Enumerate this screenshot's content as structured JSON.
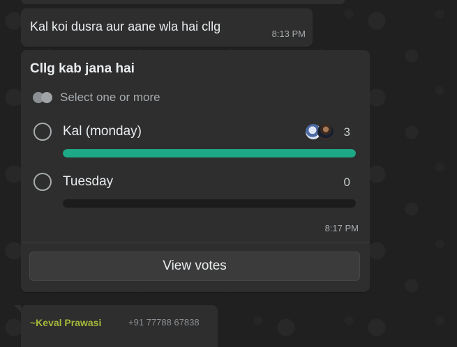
{
  "messages": [
    {
      "text": "Kal koi dusra aur aane wla hai cllg",
      "time": "8:13 PM"
    }
  ],
  "poll": {
    "question": "Cllg kab jana hai",
    "select_hint": "Select one or more",
    "options": [
      {
        "label": "Kal (monday)",
        "votes": "3",
        "fill_fraction": 1.0,
        "bar_color": "#1da886"
      },
      {
        "label": "Tuesday",
        "votes": "0",
        "fill_fraction": 0.0,
        "bar_color": "#1da886"
      }
    ],
    "time": "8:17 PM",
    "view_votes_label": "View votes"
  },
  "next_message": {
    "sender_name": "~Keval Prawasi",
    "sender_phone": "+91 77788 67838",
    "sender_color": "#a7b93a"
  },
  "theme": {
    "bubble_color": "#2e2e2e",
    "accent": "#1da886"
  }
}
